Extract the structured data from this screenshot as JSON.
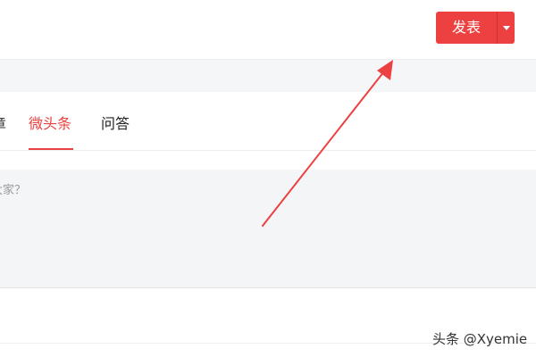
{
  "header": {
    "publish_label": "发表",
    "dropdown_icon": "caret-down-icon"
  },
  "tabs": {
    "partial_label": "章",
    "active_label": "微头条",
    "qa_label": "问答"
  },
  "composer": {
    "placeholder": "大家？"
  },
  "annotation": {
    "arrow_color": "#ed4040"
  },
  "watermark": {
    "text": "头条 @Xyemie"
  },
  "colors": {
    "accent": "#ed4040",
    "composer_bg": "#f4f5f6",
    "page_band": "#f5f6f7"
  }
}
